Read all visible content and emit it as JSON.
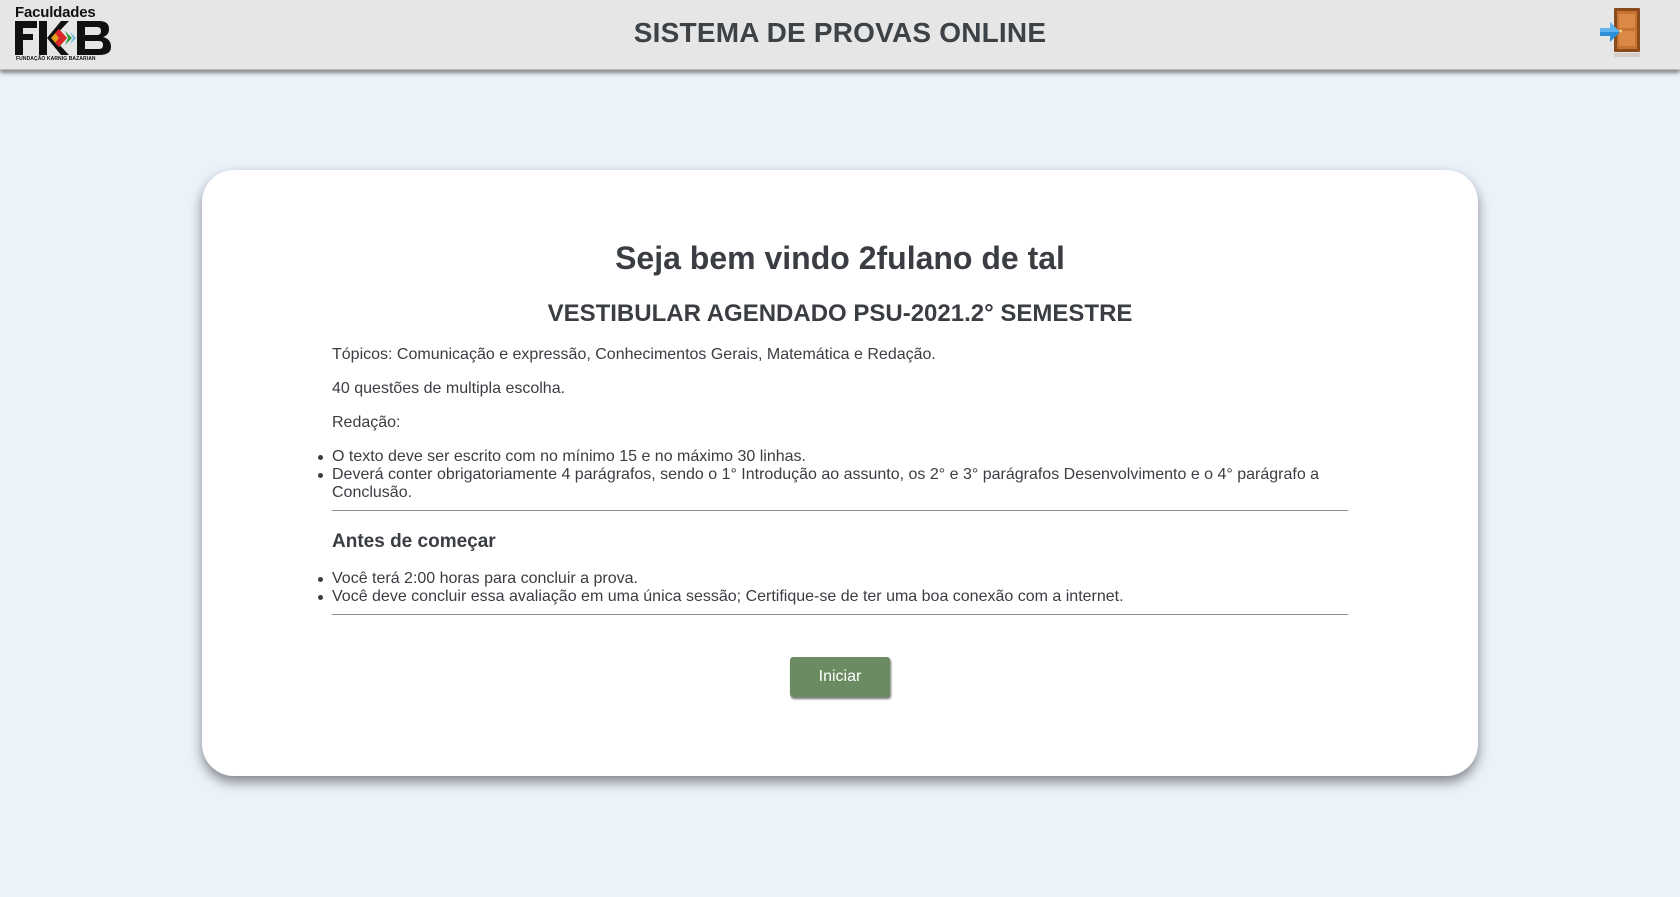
{
  "header": {
    "title": "SISTEMA DE PROVAS ONLINE",
    "logo": {
      "top_text": "Faculdades",
      "main_text": "FKB",
      "bottom_text": "FUNDAÇÃO KARNIG BAZARIAN"
    },
    "exit_icon": "door-exit-icon"
  },
  "card": {
    "welcome": "Seja bem vindo 2fulano de tal",
    "exam_title": "VESTIBULAR AGENDADO PSU-2021.2° SEMESTRE",
    "topics": "Tópicos: Comunicação e expressão, Conhecimentos Gerais, Matemática e Redação.",
    "questions": "40 questões de multipla escolha.",
    "essay_label": "Redação:",
    "essay_rules": [
      "O texto deve ser escrito com no mínimo 15 e no máximo 30 linhas.",
      "Deverá conter obrigatoriamente 4 parágrafos, sendo o 1° Introdução ao assunto, os 2° e 3° parágrafos Desenvolvimento e o 4° parágrafo a Conclusão."
    ],
    "before_start_heading": "Antes de começar",
    "before_start_items": [
      "Você terá 2:00 horas para concluir a prova.",
      "Você deve concluir essa avaliação em uma única sessão; Certifique-se de ter uma boa conexão com a internet."
    ],
    "start_button": "Iniciar"
  },
  "colors": {
    "background": "#ebf2fa",
    "header_bg": "#e6e6e6",
    "button_bg": "#6b8c62",
    "text": "#3a3d42"
  }
}
